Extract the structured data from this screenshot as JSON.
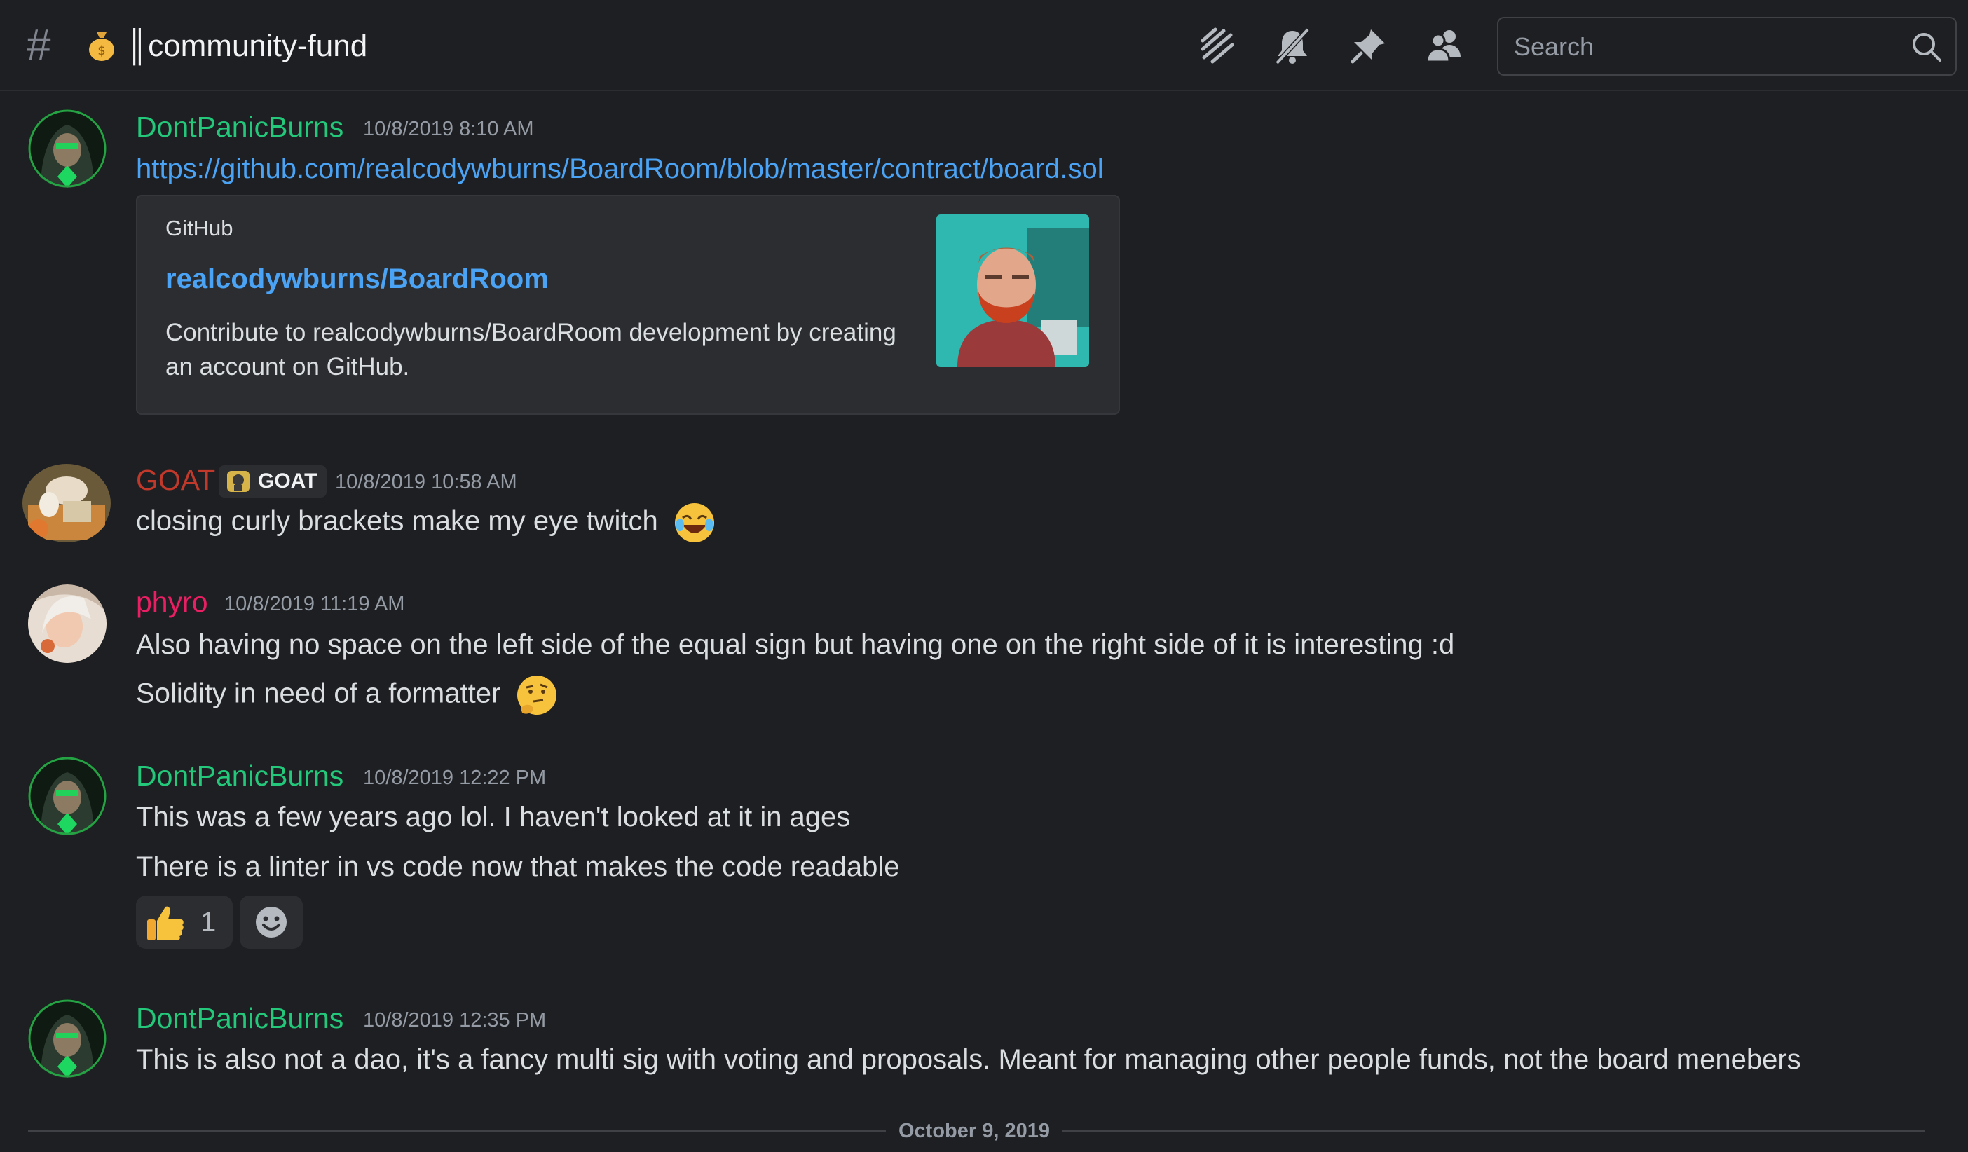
{
  "header": {
    "channel_name": "║community-fund",
    "search_placeholder": "Search",
    "icons": [
      "threads-icon",
      "mute-bell-icon",
      "pin-icon",
      "member-list-icon",
      "search-icon"
    ]
  },
  "messages": [
    {
      "author": "DontPanicBurns",
      "author_color": "#23c87a",
      "timestamp": "10/8/2019 8:10 AM",
      "link": "https://github.com/realcodywburns/BoardRoom/blob/master/contract/board.sol",
      "embed": {
        "provider": "GitHub",
        "title": "realcodywburns/BoardRoom",
        "description": "Contribute to realcodywburns/BoardRoom development by creating an account on GitHub."
      }
    },
    {
      "author": "GOAT",
      "author_color": "#c0392b",
      "badge": "GOAT",
      "timestamp": "10/8/2019 10:58 AM",
      "lines": [
        "closing curly brackets make my eye twitch"
      ],
      "emoji": "joy-emoji"
    },
    {
      "author": "phyro",
      "author_color": "#e91e63",
      "timestamp": "10/8/2019 11:19 AM",
      "lines": [
        "Also having no space on the left side of the equal sign but having one on the right side of it is interesting :d",
        "Solidity in need of a formatter"
      ],
      "emoji": "thinking-emoji"
    },
    {
      "author": "DontPanicBurns",
      "author_color": "#23c87a",
      "timestamp": "10/8/2019 12:22 PM",
      "lines": [
        "This was a few years ago lol. I haven't looked at it in ages",
        "There is a linter in vs code now that makes the code readable"
      ],
      "reactions": [
        {
          "emoji": "thumbs-up-emoji",
          "count": "1"
        }
      ]
    },
    {
      "author": "DontPanicBurns",
      "author_color": "#23c87a",
      "timestamp": "10/8/2019 12:35 PM",
      "lines": [
        "This is also not a dao, it's a fancy multi sig with voting and proposals. Meant for managing other people funds, not the board menebers"
      ]
    }
  ],
  "date_divider": "October 9, 2019",
  "colors": {
    "background": "#1e1f22",
    "embed_bg": "#2b2d31",
    "link": "#4aa3f5",
    "muted": "#949ba4"
  }
}
